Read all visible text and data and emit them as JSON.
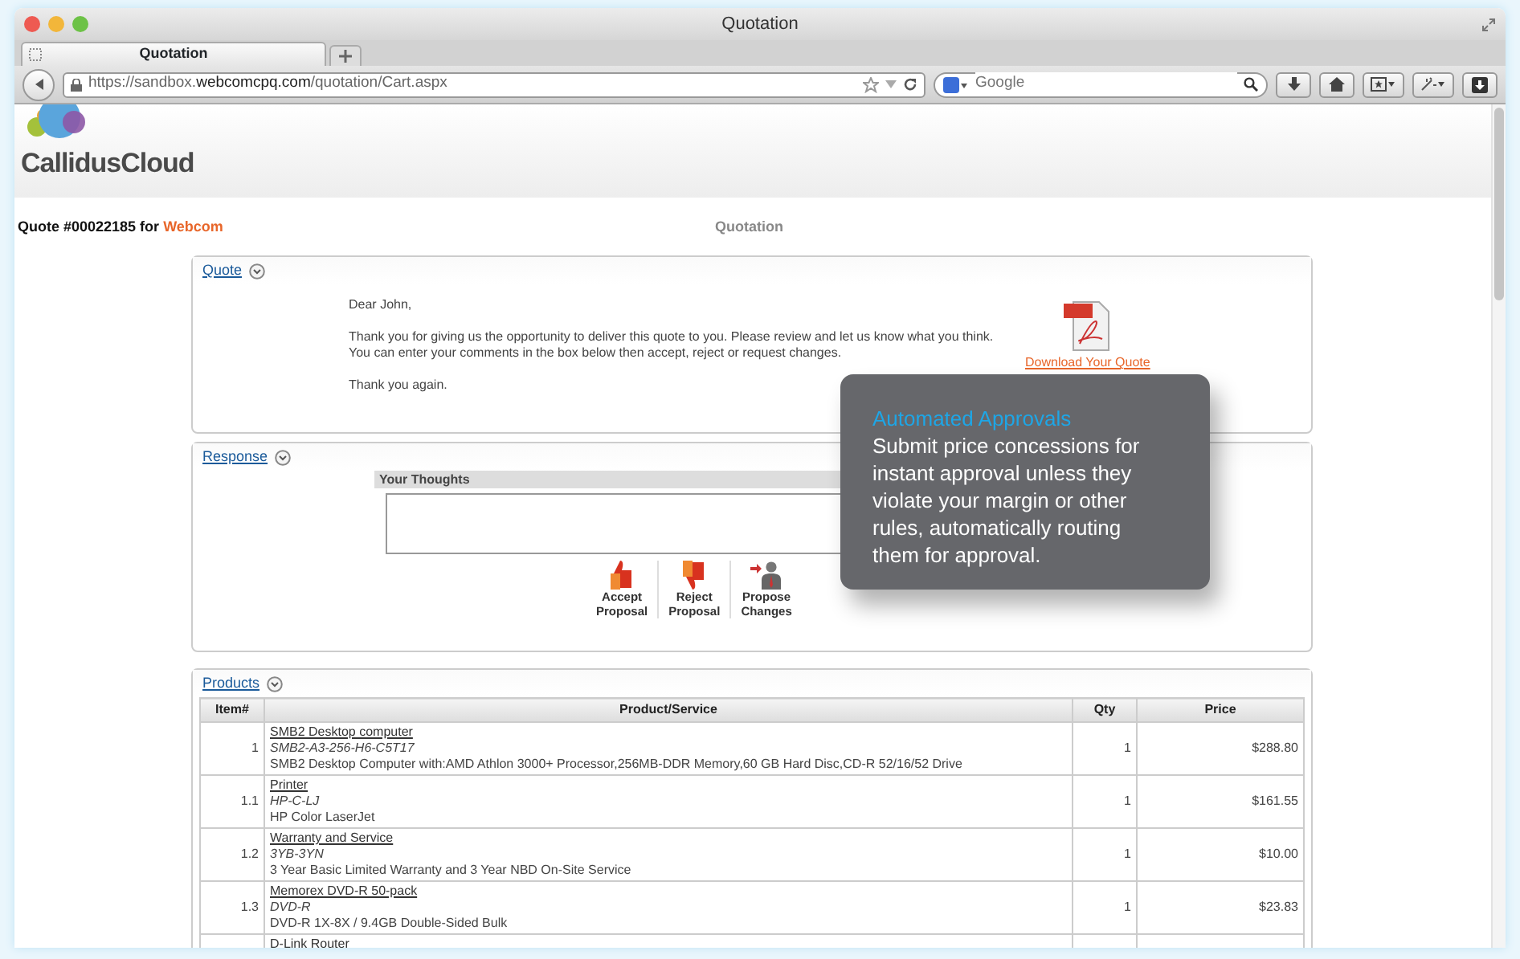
{
  "window": {
    "title": "Quotation"
  },
  "tabs": [
    {
      "label": "Quotation",
      "selected": true
    }
  ],
  "address_bar": {
    "url": "https://sandbox.**webcomcpq.com**/quotation/Cart.aspx"
  },
  "search": {
    "placeholder": "Google"
  },
  "page": {
    "logo": "CallidusCloud",
    "quote_number": "Quote #00022185 for",
    "customer": "Webcom",
    "title": "Quotation"
  },
  "quote_section": {
    "title": "Quote",
    "paragraphs": [
      [
        "Dear John,"
      ],
      [
        "Thank you for giving us the opportunity to deliver this quote to you. Please review and let us know what you think.",
        "You can enter your comments in the box below then accept, reject or request changes."
      ],
      [
        "Thank you again."
      ]
    ],
    "download_link": "Download Your Quote"
  },
  "response_section": {
    "title": "Response",
    "field_label": "Your Thoughts",
    "actions": [
      {
        "kind": "accept",
        "line1": "Accept",
        "line2": "Proposal"
      },
      {
        "kind": "reject",
        "line1": "Reject",
        "line2": "Proposal"
      },
      {
        "kind": "propose",
        "line1": "Propose",
        "line2": "Changes"
      }
    ]
  },
  "products_section": {
    "title": "Products",
    "columns": [
      "Item#",
      "Product/Service",
      "Qty",
      "Price"
    ],
    "rows": [
      {
        "item": "1",
        "name": "SMB2 Desktop computer",
        "sku": "SMB2-A3-256-H6-C5T17",
        "description": "SMB2 Desktop Computer with:AMD Athlon 3000+ Processor,256MB-DDR Memory,60 GB Hard Disc,CD-R 52/16/52 Drive",
        "qty": "1",
        "price": "$288.80"
      },
      {
        "item": "1.1",
        "name": "Printer",
        "sku": "HP-C-LJ",
        "description": "HP Color LaserJet",
        "qty": "1",
        "price": "$161.55"
      },
      {
        "item": "1.2",
        "name": "Warranty and Service",
        "sku": "3YB-3YN",
        "description": "3 Year Basic Limited Warranty and 3 Year NBD On-Site Service",
        "qty": "1",
        "price": "$10.00"
      },
      {
        "item": "1.3",
        "name": "Memorex DVD-R 50-pack",
        "sku": "DVD-R",
        "description": "DVD-R 1X-8X / 9.4GB Double-Sided Bulk",
        "qty": "1",
        "price": "$23.83"
      },
      {
        "name": "D-Link Router"
      }
    ]
  },
  "callout": {
    "title": "Automated Approvals",
    "body": "Submit price concessions for instant approval unless they violate your margin or other rules, automatically routing them for approval."
  }
}
